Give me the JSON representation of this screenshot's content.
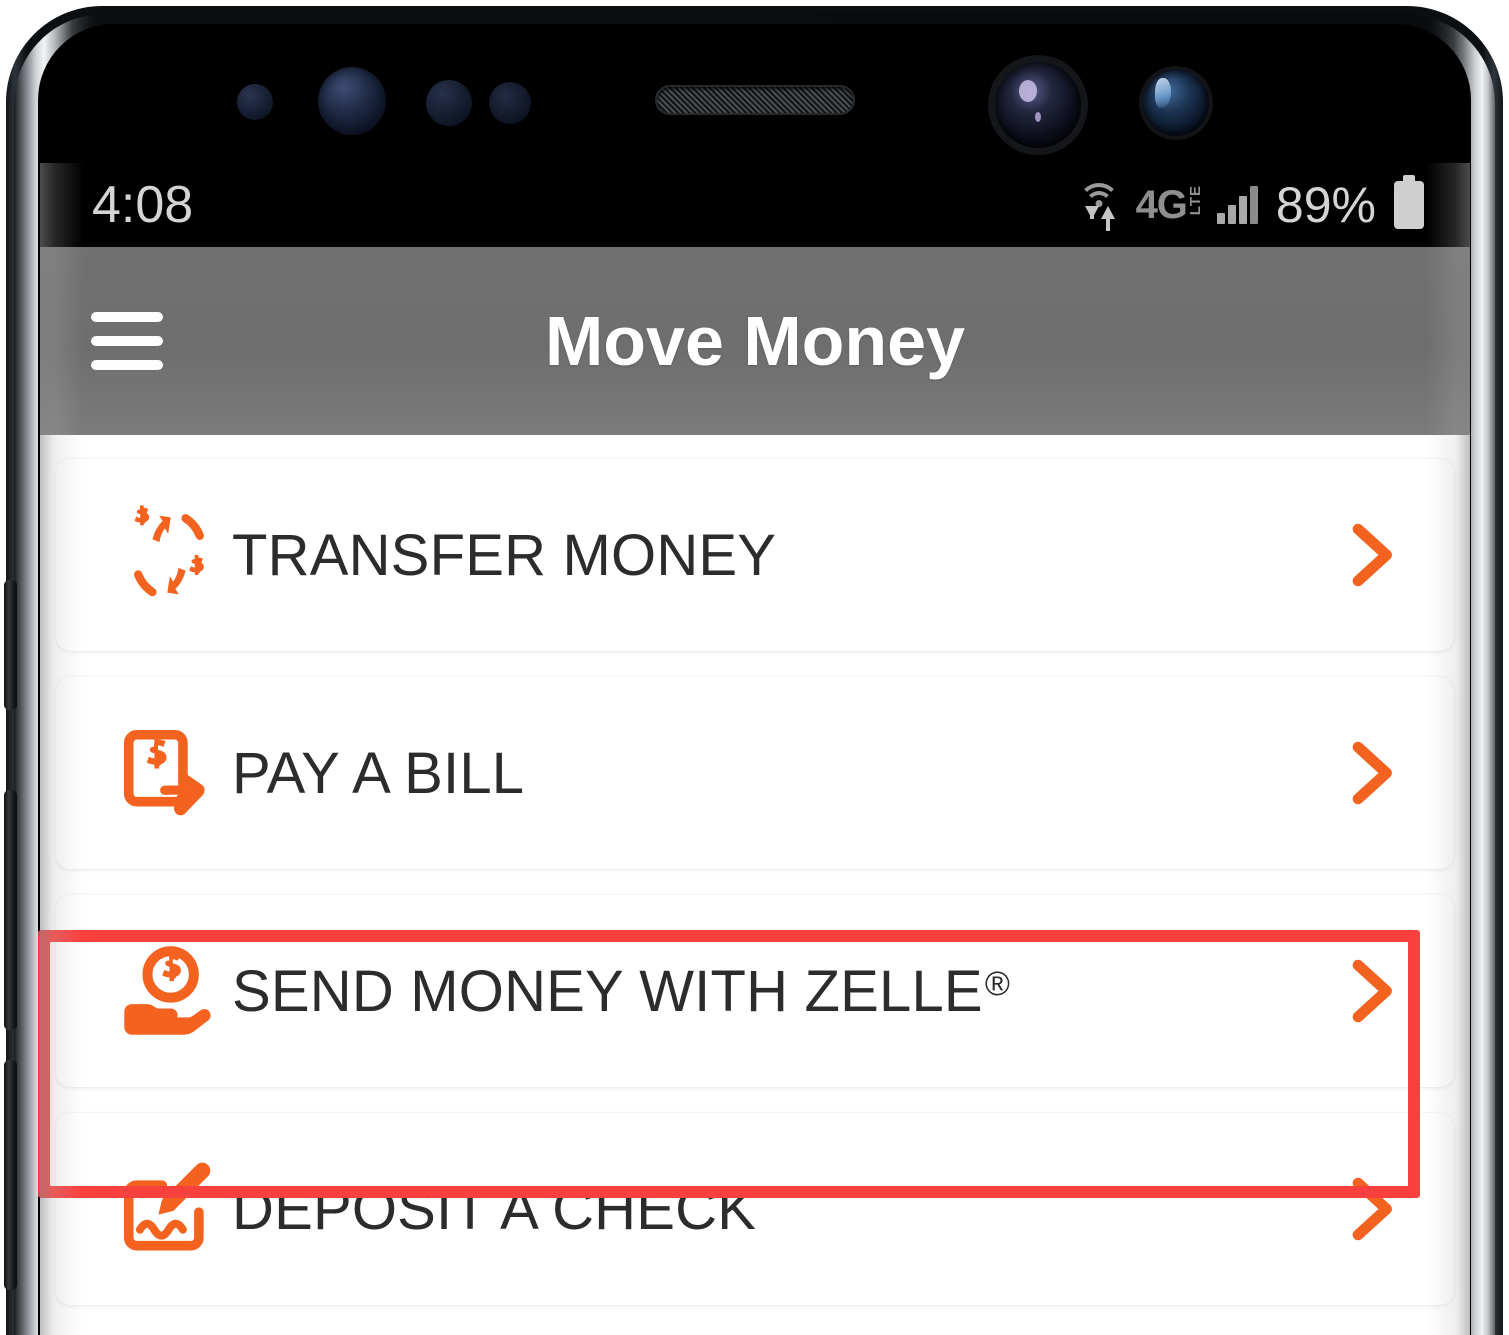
{
  "device": {
    "frame": "smartphone",
    "sensors": [
      "proximity-sensor",
      "iris-scanner",
      "light-sensor",
      "ir-sensor",
      "earpiece-speaker",
      "front-camera-main",
      "front-camera-secondary"
    ]
  },
  "status_bar": {
    "time": "4:08",
    "wifi_icon": "wifi-data-transfer-icon",
    "network_label": "4G",
    "network_sub": "LTE",
    "signal_icon": "signal-bars-icon",
    "battery_percent": "89%",
    "battery_icon": "battery-icon"
  },
  "header": {
    "menu_icon": "hamburger-menu-icon",
    "title": "Move Money",
    "background_color": "#6e6e6e"
  },
  "colors": {
    "accent_orange": "#f4621f",
    "highlight_red": "#f8403f",
    "text_dark": "#2c2c2c",
    "header_gray": "#6e6e6e"
  },
  "menu_items": [
    {
      "label": "TRANSFER MONEY",
      "icon": "transfer-money-icon",
      "chevron": "chevron-right-icon",
      "highlighted": false
    },
    {
      "label": "PAY A BILL",
      "icon": "pay-bill-icon",
      "chevron": "chevron-right-icon",
      "highlighted": false
    },
    {
      "label": "SEND MONEY WITH ZELLE",
      "label_suffix": "®",
      "icon": "hand-holding-coin-icon",
      "chevron": "chevron-right-icon",
      "highlighted": true
    },
    {
      "label": "DEPOSIT A CHECK",
      "icon": "deposit-check-icon",
      "chevron": "chevron-right-icon",
      "highlighted": false
    }
  ],
  "annotation": {
    "type": "rectangle-highlight",
    "color": "#f8403f",
    "target": "SEND MONEY WITH ZELLE"
  }
}
